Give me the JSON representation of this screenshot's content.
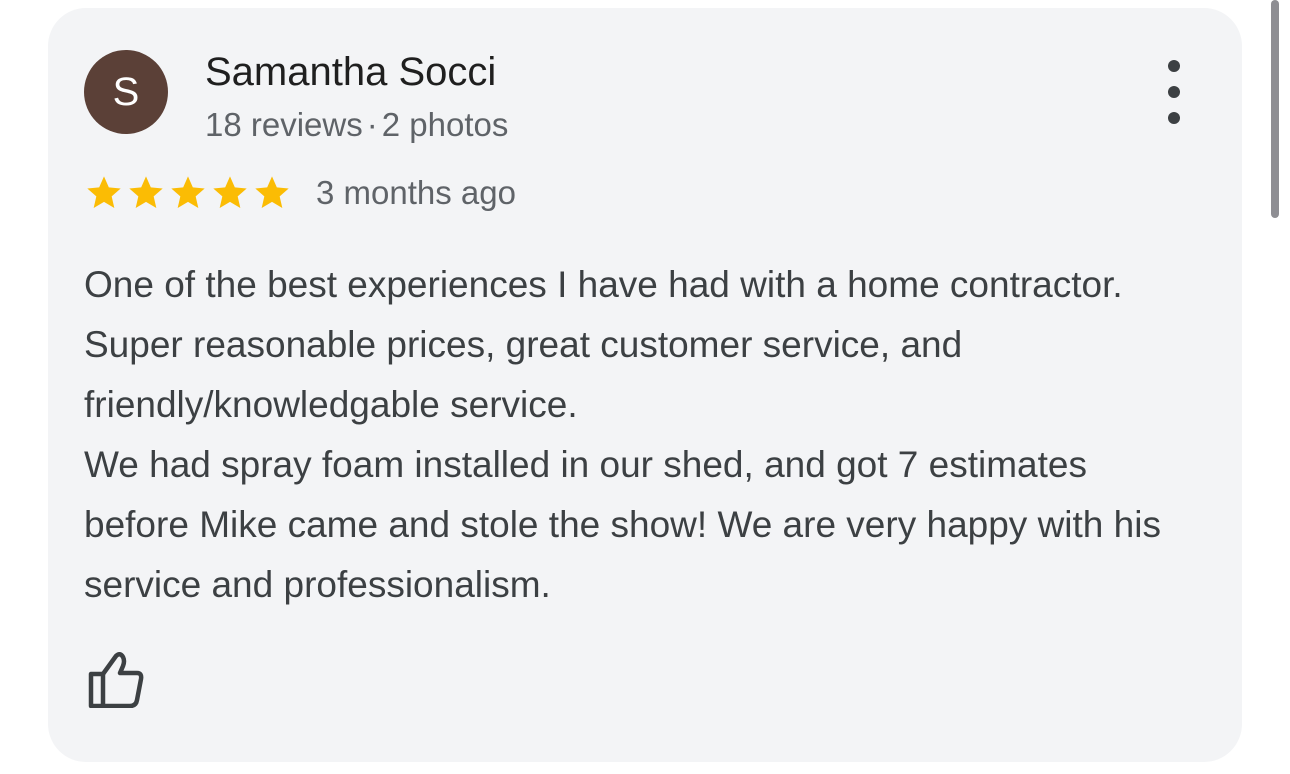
{
  "review": {
    "author": {
      "initial": "S",
      "name": "Samantha Socci",
      "reviews": "18 reviews",
      "separator": "·",
      "photos": "2 photos",
      "avatar_color": "#5b4037"
    },
    "rating": 5,
    "star_color": "#fbbc04",
    "date": "3 months ago",
    "paragraphs": [
      "One of the best experiences I have had with a home contractor. Super reasonable prices, great customer service, and friendly/knowledgable service.",
      "We had spray foam installed in our shed, and got 7 estimates before Mike came and stole the show! We are very happy with his service and professionalism."
    ],
    "icons": {
      "more": "more-vert-icon",
      "like": "thumbs-up-icon"
    }
  }
}
